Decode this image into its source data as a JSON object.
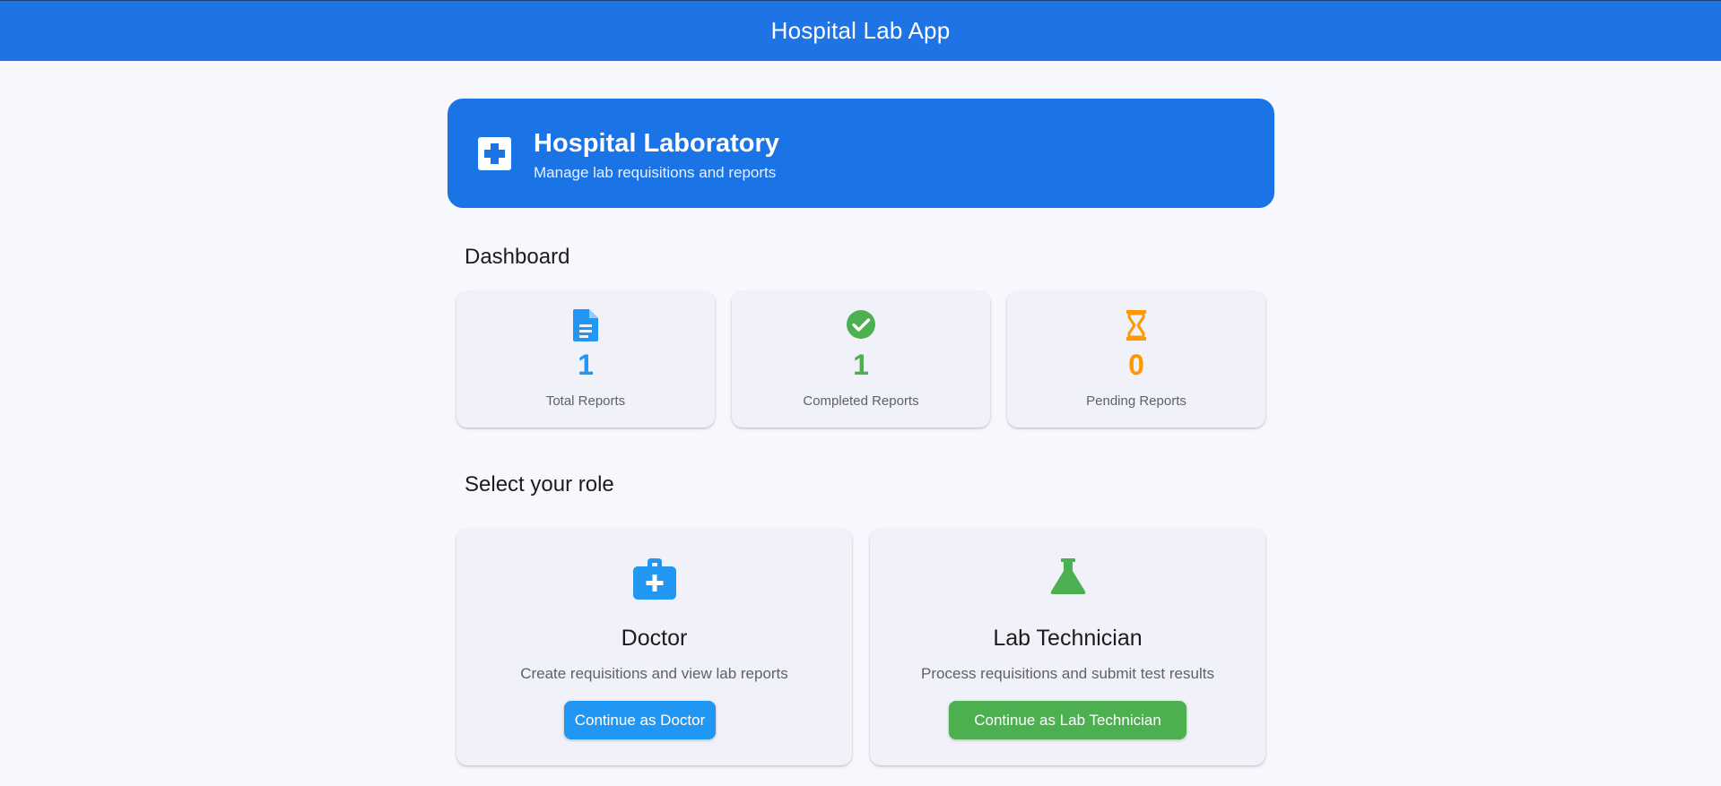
{
  "app": {
    "title": "Hospital Lab App"
  },
  "hero": {
    "title": "Hospital Laboratory",
    "subtitle": "Manage lab requisitions and reports",
    "icon": "medical-cross-icon"
  },
  "dashboard": {
    "title": "Dashboard",
    "stats": [
      {
        "value": "1",
        "label": "Total Reports",
        "icon": "document-icon",
        "color": "#2196f3"
      },
      {
        "value": "1",
        "label": "Completed Reports",
        "icon": "check-circle-icon",
        "color": "#4caf50"
      },
      {
        "value": "0",
        "label": "Pending Reports",
        "icon": "hourglass-icon",
        "color": "#ff9800"
      }
    ]
  },
  "roles": {
    "title": "Select your role",
    "items": [
      {
        "title": "Doctor",
        "description": "Create requisitions and view lab reports",
        "button": "Continue as Doctor",
        "icon": "medical-bag-icon",
        "color": "#2196f3"
      },
      {
        "title": "Lab Technician",
        "description": "Process requisitions and submit test results",
        "button": "Continue as Lab Technician",
        "icon": "flask-icon",
        "color": "#4caf50"
      }
    ]
  }
}
